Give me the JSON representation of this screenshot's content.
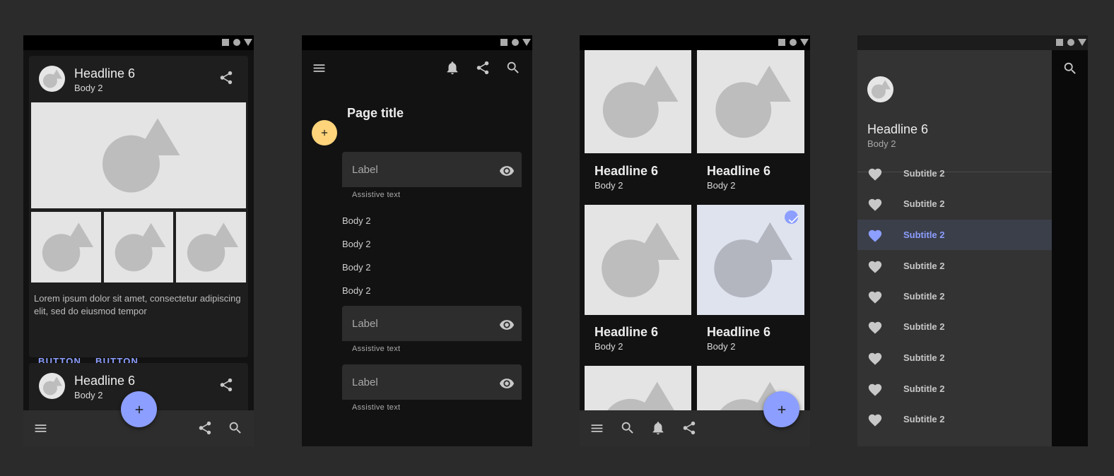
{
  "screen1": {
    "card1": {
      "headline": "Headline 6",
      "body": "Body 2"
    },
    "lorem": "Lorem ipsum dolor sit amet, consectetur adipiscing elit, sed do eiusmod tempor",
    "button1": "BUTTON",
    "button2": "BUTTON",
    "card2": {
      "headline": "Headline 6",
      "body": "Body 2"
    },
    "fab_icon": "add-icon"
  },
  "screen2": {
    "page_title": "Page title",
    "fields": [
      {
        "label": "Label",
        "assistive": "Assistive text"
      },
      {
        "label": "Label",
        "assistive": "Assistive text"
      },
      {
        "label": "Label",
        "assistive": "Assistive text"
      }
    ],
    "body_items": [
      "Body 2",
      "Body 2",
      "Body 2",
      "Body 2"
    ]
  },
  "screen3": {
    "tiles": [
      {
        "headline": "Headline 6",
        "body": "Body 2",
        "selected": false
      },
      {
        "headline": "Headline 6",
        "body": "Body 2",
        "selected": false
      },
      {
        "headline": "Headline 6",
        "body": "Body 2",
        "selected": false
      },
      {
        "headline": "Headline 6",
        "body": "Body 2",
        "selected": true
      }
    ]
  },
  "screen4": {
    "drawer_headline": "Headline 6",
    "drawer_body": "Body 2",
    "items": [
      "Subtitle 2",
      "Subtitle 2",
      "Subtitle 2",
      "Subtitle 2",
      "Subtitle 2",
      "Subtitle 2",
      "Subtitle 2",
      "Subtitle 2",
      "Subtitle 2"
    ],
    "active_index": 2
  },
  "colors": {
    "background": "#2b2b2b",
    "surface": "#121212",
    "accent": "#8c9eff",
    "fab_secondary": "#ffd47a"
  }
}
